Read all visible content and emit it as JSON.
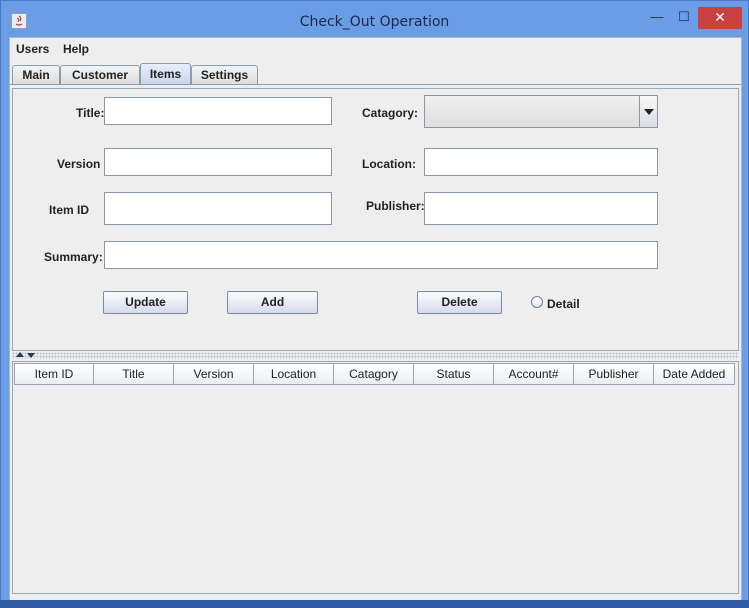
{
  "window": {
    "title": "Check_Out Operation",
    "minimize_glyph": "—",
    "maximize_glyph": "☐",
    "close_glyph": "✕"
  },
  "menu": [
    "Users",
    "Help"
  ],
  "tabs": [
    {
      "label": "Main",
      "active": false
    },
    {
      "label": "Customer",
      "active": false
    },
    {
      "label": "Items",
      "active": true
    },
    {
      "label": "Settings",
      "active": false
    }
  ],
  "form": {
    "title_label": "Title:",
    "title_value": "",
    "category_label": "Catagory:",
    "category_value": "",
    "version_label": "Version",
    "version_value": "",
    "location_label": "Location:",
    "location_value": "",
    "item_id_label": "Item ID",
    "item_id_value": "",
    "publisher_label": "Publisher:",
    "publisher_value": "",
    "summary_label": "Summary:",
    "summary_value": ""
  },
  "buttons": {
    "update": "Update",
    "add": "Add",
    "delete": "Delete"
  },
  "detail_radio": {
    "label": "Detail",
    "checked": false
  },
  "table": {
    "columns": [
      "Item ID",
      "Title",
      "Version",
      "Location",
      "Catagory",
      "Status",
      "Account#",
      "Publisher",
      "Date Added"
    ],
    "rows": []
  },
  "colors": {
    "title_bar": "#6b9ce6",
    "close_button": "#c94242",
    "panel_bg": "#eeeeee"
  }
}
